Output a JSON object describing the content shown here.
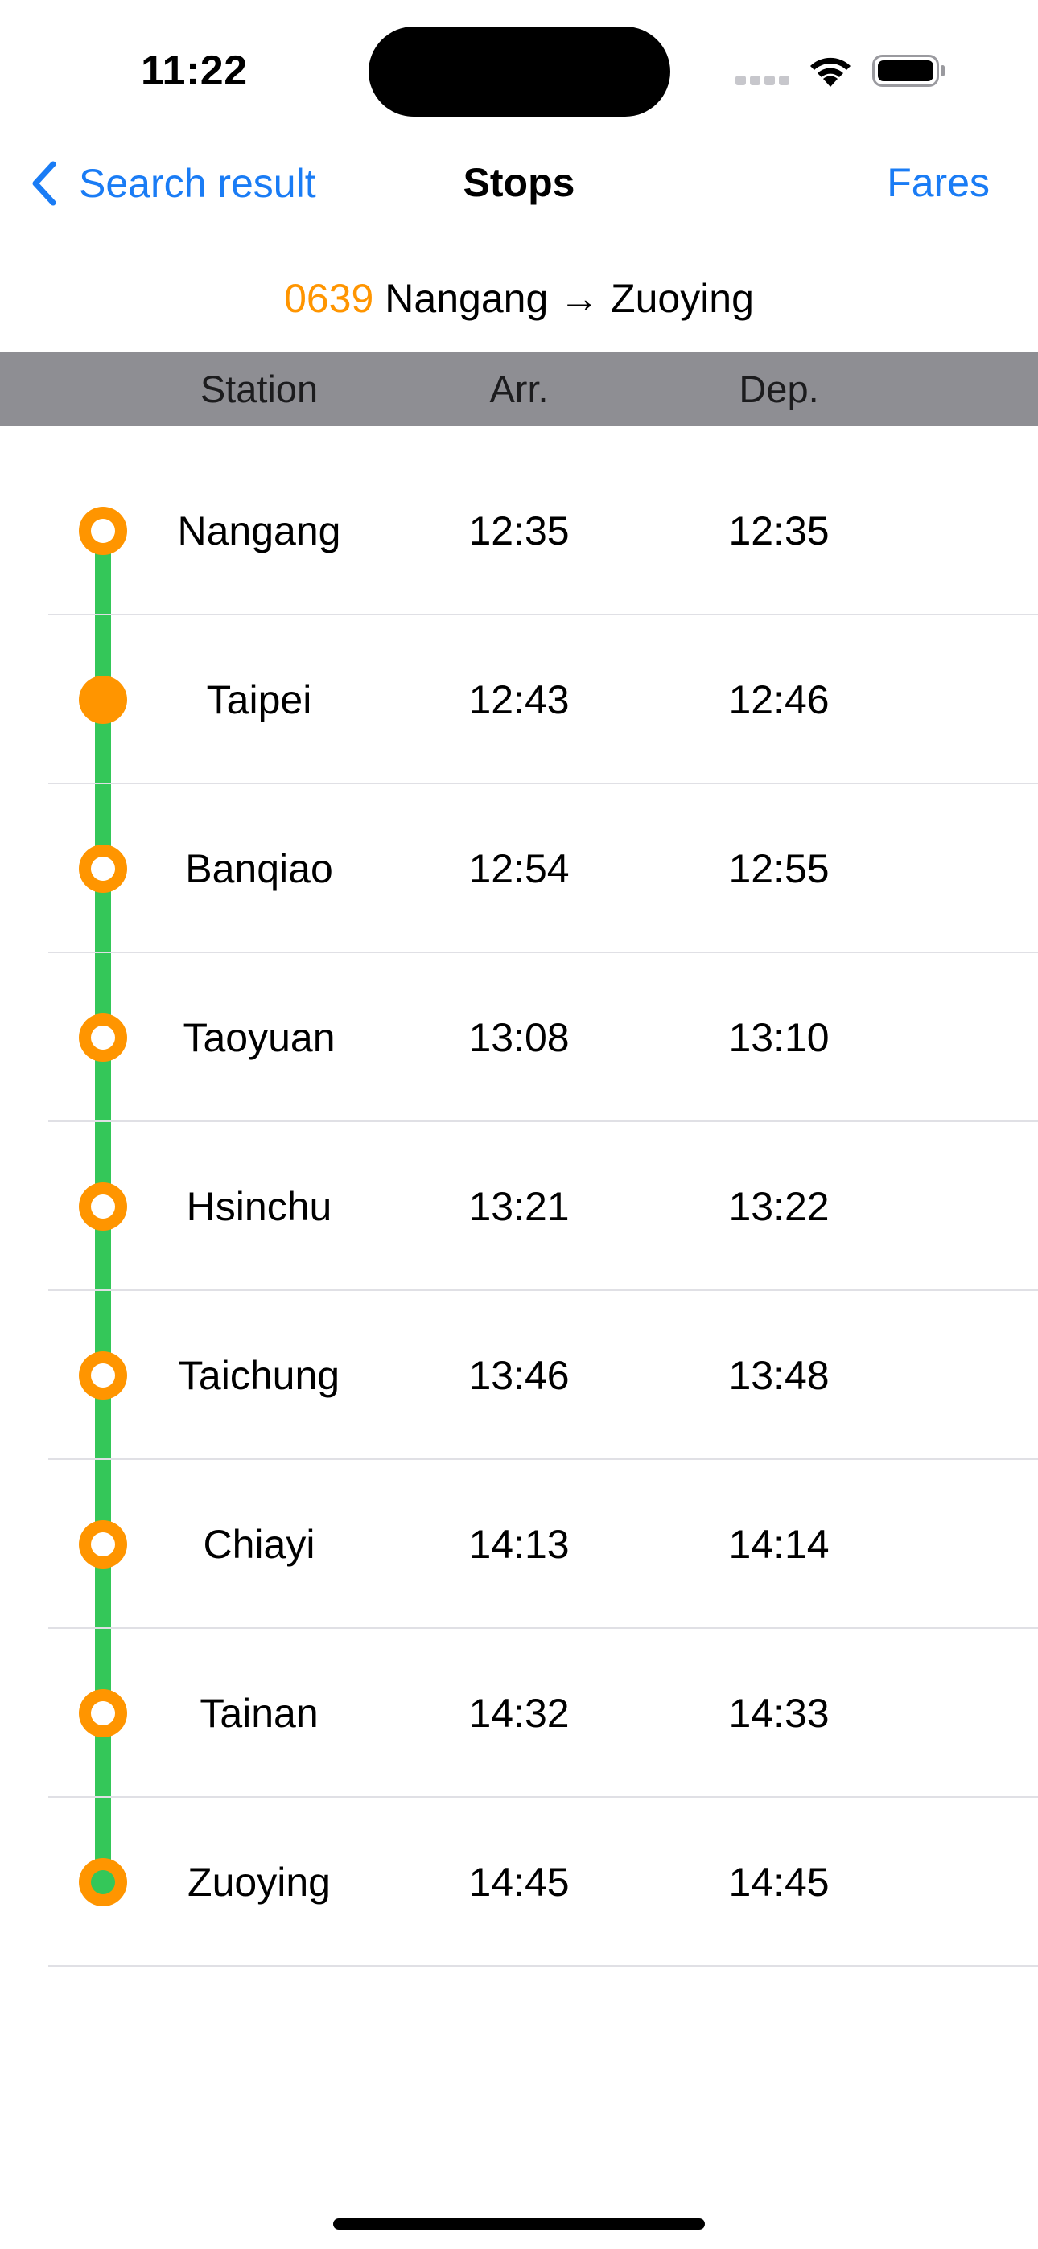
{
  "status_bar": {
    "time": "11:22",
    "icons": [
      "cellular-signal-icon",
      "wifi-icon",
      "battery-icon"
    ]
  },
  "nav": {
    "back_label": "Search result",
    "title": "Stops",
    "fares_label": "Fares"
  },
  "train": {
    "number": "0639",
    "route": "Nangang → Zuoying",
    "number_color": "#ff9500"
  },
  "columns": {
    "station": "Station",
    "arr": "Arr.",
    "dep": "Dep."
  },
  "stops": [
    {
      "station": "Nangang",
      "arr": "12:35",
      "dep": "12:35",
      "marker": "hollow"
    },
    {
      "station": "Taipei",
      "arr": "12:43",
      "dep": "12:46",
      "marker": "filled"
    },
    {
      "station": "Banqiao",
      "arr": "12:54",
      "dep": "12:55",
      "marker": "hollow"
    },
    {
      "station": "Taoyuan",
      "arr": "13:08",
      "dep": "13:10",
      "marker": "hollow"
    },
    {
      "station": "Hsinchu",
      "arr": "13:21",
      "dep": "13:22",
      "marker": "hollow"
    },
    {
      "station": "Taichung",
      "arr": "13:46",
      "dep": "13:48",
      "marker": "hollow"
    },
    {
      "station": "Chiayi",
      "arr": "14:13",
      "dep": "14:14",
      "marker": "hollow"
    },
    {
      "station": "Tainan",
      "arr": "14:32",
      "dep": "14:33",
      "marker": "hollow"
    },
    {
      "station": "Zuoying",
      "arr": "14:45",
      "dep": "14:45",
      "marker": "terminal"
    }
  ],
  "colors": {
    "accent": "#1a7cf5",
    "route_line": "#34c759",
    "stop_marker": "#ff9500",
    "header_bg": "#8e8e93"
  }
}
